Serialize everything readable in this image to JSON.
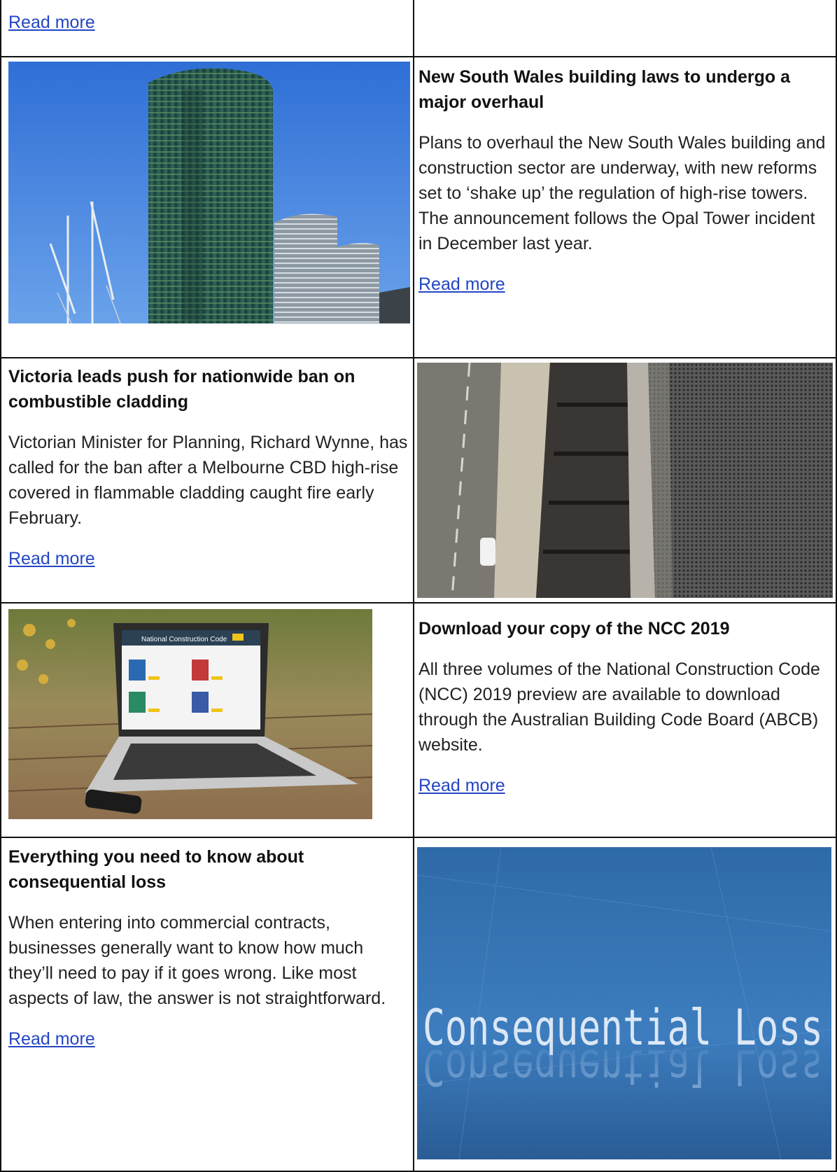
{
  "top_row": {
    "read_more": "Read more"
  },
  "articles": [
    {
      "title": "New South Wales building laws to undergo a major overhaul",
      "body": "Plans to overhaul the New South Wales building and construction sector are underway, with new reforms set to ‘shake up’ the regulation of high-rise towers. The announcement follows the Opal Tower incident in December last year.",
      "read_more": "Read more",
      "image": "opal-tower-photo"
    },
    {
      "title": "Victoria leads push for nationwide ban on combustible cladding",
      "body": "Victorian Minister for Planning, Richard Wynne, has called for the ban after a Melbourne CBD high-rise covered in flammable cladding caught fire early February.",
      "read_more": "Read more",
      "image": "burnt-balconies-photo"
    },
    {
      "title": "Download your copy of the NCC 2019",
      "body": "All three volumes of the National Construction Code (NCC) 2019 preview are available to download through the Australian Building Code Board (ABCB) website.",
      "read_more": "Read more",
      "image": "laptop-ncc-photo",
      "image_text": {
        "site_title": "National Construction Code"
      }
    },
    {
      "title": "Everything you need to know about consequential loss",
      "body": "When entering into commercial contracts, businesses generally want to know how much they’ll need to pay if it goes wrong. Like most aspects of law, the answer is not straightforward.",
      "read_more": "Read more",
      "image": "consequential-loss-graphic",
      "image_text": {
        "caption": "Consequential Loss"
      }
    }
  ],
  "colors": {
    "link": "#2446c4",
    "border": "#111111"
  }
}
